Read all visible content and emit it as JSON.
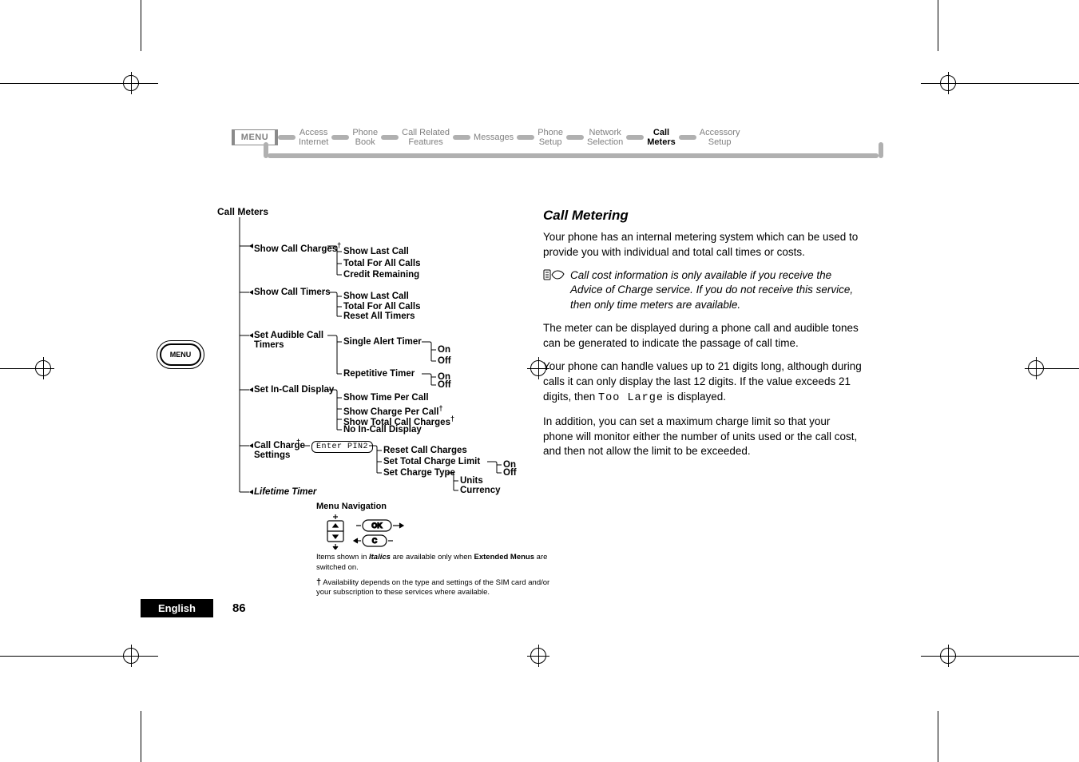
{
  "menuBar": {
    "root": "MENU",
    "items": [
      "Access\nInternet",
      "Phone\nBook",
      "Call Related\nFeatures",
      "Messages",
      "Phone\nSetup",
      "Network\nSelection",
      "Call\nMeters",
      "Accessory\nSetup"
    ],
    "activeIndex": 6
  },
  "menuKey": "MENU",
  "tree": {
    "title": "Call Meters",
    "nodes": {
      "showCallCharges": "Show Call Charges",
      "showLastCall1": "Show Last Call",
      "totalAll1": "Total For All Calls",
      "creditRemaining": "Credit Remaining",
      "showCallTimers": "Show Call Timers",
      "showLastCall2": "Show Last Call",
      "totalAll2": "Total For All Calls",
      "resetAllTimers": "Reset All Timers",
      "setAudible": "Set Audible Call\nTimers",
      "singleAlert": "Single Alert Timer",
      "on1": "On",
      "off1": "Off",
      "repetitive": "Repetitive Timer",
      "on2": "On",
      "off2": "Off",
      "setInCall": "Set In-Call Display",
      "showTimePerCall": "Show Time Per Call",
      "showChargePerCall": "Show Charge Per Call",
      "showTotalCallCharges": "Show Total Call Charges",
      "noInCall": "No In-Call Display",
      "callChargeSettings": "Call Charge\nSettings",
      "enterPin": "Enter PIN2",
      "resetCallCharges": "Reset Call Charges",
      "setTotalChargeLimit": "Set Total Charge Limit",
      "setChargeType": "Set Charge Type",
      "on3": "On",
      "off3": "Off",
      "units": "Units",
      "currency": "Currency",
      "lifetime": "Lifetime Timer"
    }
  },
  "navPanel": {
    "header": "Menu Navigation",
    "ok": "OK",
    "c": "C",
    "note1a": "Items shown in ",
    "note1b": "Italics",
    "note1c": " are available only when ",
    "note1d": "Extended Menus",
    "note1e": " are switched on.",
    "note2": "Availability depends on the type and settings of the SIM card and/or your subscription to these services where available."
  },
  "rightCol": {
    "heading": "Call Metering",
    "p1": "Your phone has an internal metering system which can be used to provide you with individual and total call times or costs.",
    "notice": "Call cost information is only available if you receive the Advice of Charge service. If you do not receive this service, then only time meters are available.",
    "p2": "The meter can be displayed during a phone call and audible tones can be generated to indicate the passage of call time.",
    "p3a": "Your phone can handle values up to 21 digits long, although during calls it can only display the last 12 digits. If the value exceeds 21 digits, then ",
    "p3code": "Too Large",
    "p3b": " is displayed.",
    "p4": "In addition, you can set a maximum charge limit so that your phone will monitor either the number of units used or the call cost, and then not allow the limit to be exceeded."
  },
  "footer": {
    "lang": "English",
    "page": "86"
  }
}
